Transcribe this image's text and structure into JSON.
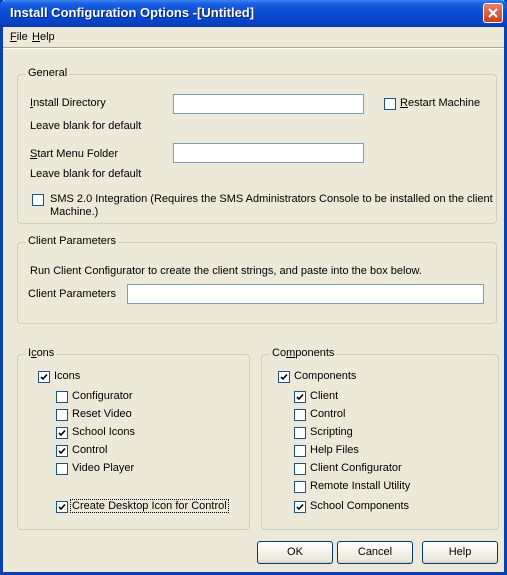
{
  "window": {
    "title": "Install Configuration Options -[Untitled]"
  },
  "menu": {
    "file": "File",
    "file_key": "F",
    "file_rest": "ile",
    "help": "Help",
    "help_key": "H",
    "help_rest": "elp"
  },
  "general": {
    "legend": "General",
    "install_dir_label_key": "I",
    "install_dir_label_rest": "nstall Directory",
    "install_dir_value": "",
    "install_dir_hint": "Leave blank for default",
    "restart_key": "R",
    "restart_rest": "estart Machine",
    "restart_checked": false,
    "start_menu_label_key": "S",
    "start_menu_label_rest": "tart Menu Folder",
    "start_menu_value": "",
    "start_menu_hint": "Leave blank for default",
    "sms_line1": "SMS 2.0 Integration (Requires the SMS Administrators Console to be installed on the client",
    "sms_line2": "Machine.)",
    "sms_checked": false
  },
  "client_params": {
    "legend": "Client Parameters",
    "instruction": "Run Client Configurator to create the client strings, and paste into the box below.",
    "field_label": "Client Parameters",
    "value": ""
  },
  "icons": {
    "legend_pre": "I",
    "legend_key": "c",
    "legend_rest": "ons",
    "master": {
      "label": "Icons",
      "checked": true
    },
    "items": [
      {
        "label": "Configurator",
        "checked": false
      },
      {
        "label": "Reset Video",
        "checked": false
      },
      {
        "label": "School Icons",
        "checked": true
      },
      {
        "label": "Control",
        "checked": true
      },
      {
        "label": "Video Player",
        "checked": false
      }
    ],
    "desktop": {
      "label": "Create Desktop Icon for Control",
      "checked": true
    }
  },
  "components": {
    "legend_pre": "Co",
    "legend_key": "m",
    "legend_rest": "ponents",
    "master": {
      "label": "Components",
      "checked": true
    },
    "items": [
      {
        "label": "Client",
        "checked": true
      },
      {
        "label": "Control",
        "checked": false
      },
      {
        "label": "Scripting",
        "checked": false
      },
      {
        "label": "Help Files",
        "checked": false
      },
      {
        "label": "Client Configurator",
        "checked": false
      },
      {
        "label": "Remote Install Utility",
        "checked": false
      },
      {
        "label": "School Components",
        "checked": true
      }
    ]
  },
  "buttons": {
    "ok": "OK",
    "cancel": "Cancel",
    "help": "Help"
  },
  "colors": {
    "title_bar": "#0a4bd6",
    "window_bg": "#ece9d8",
    "check_mark": "#21a121"
  }
}
